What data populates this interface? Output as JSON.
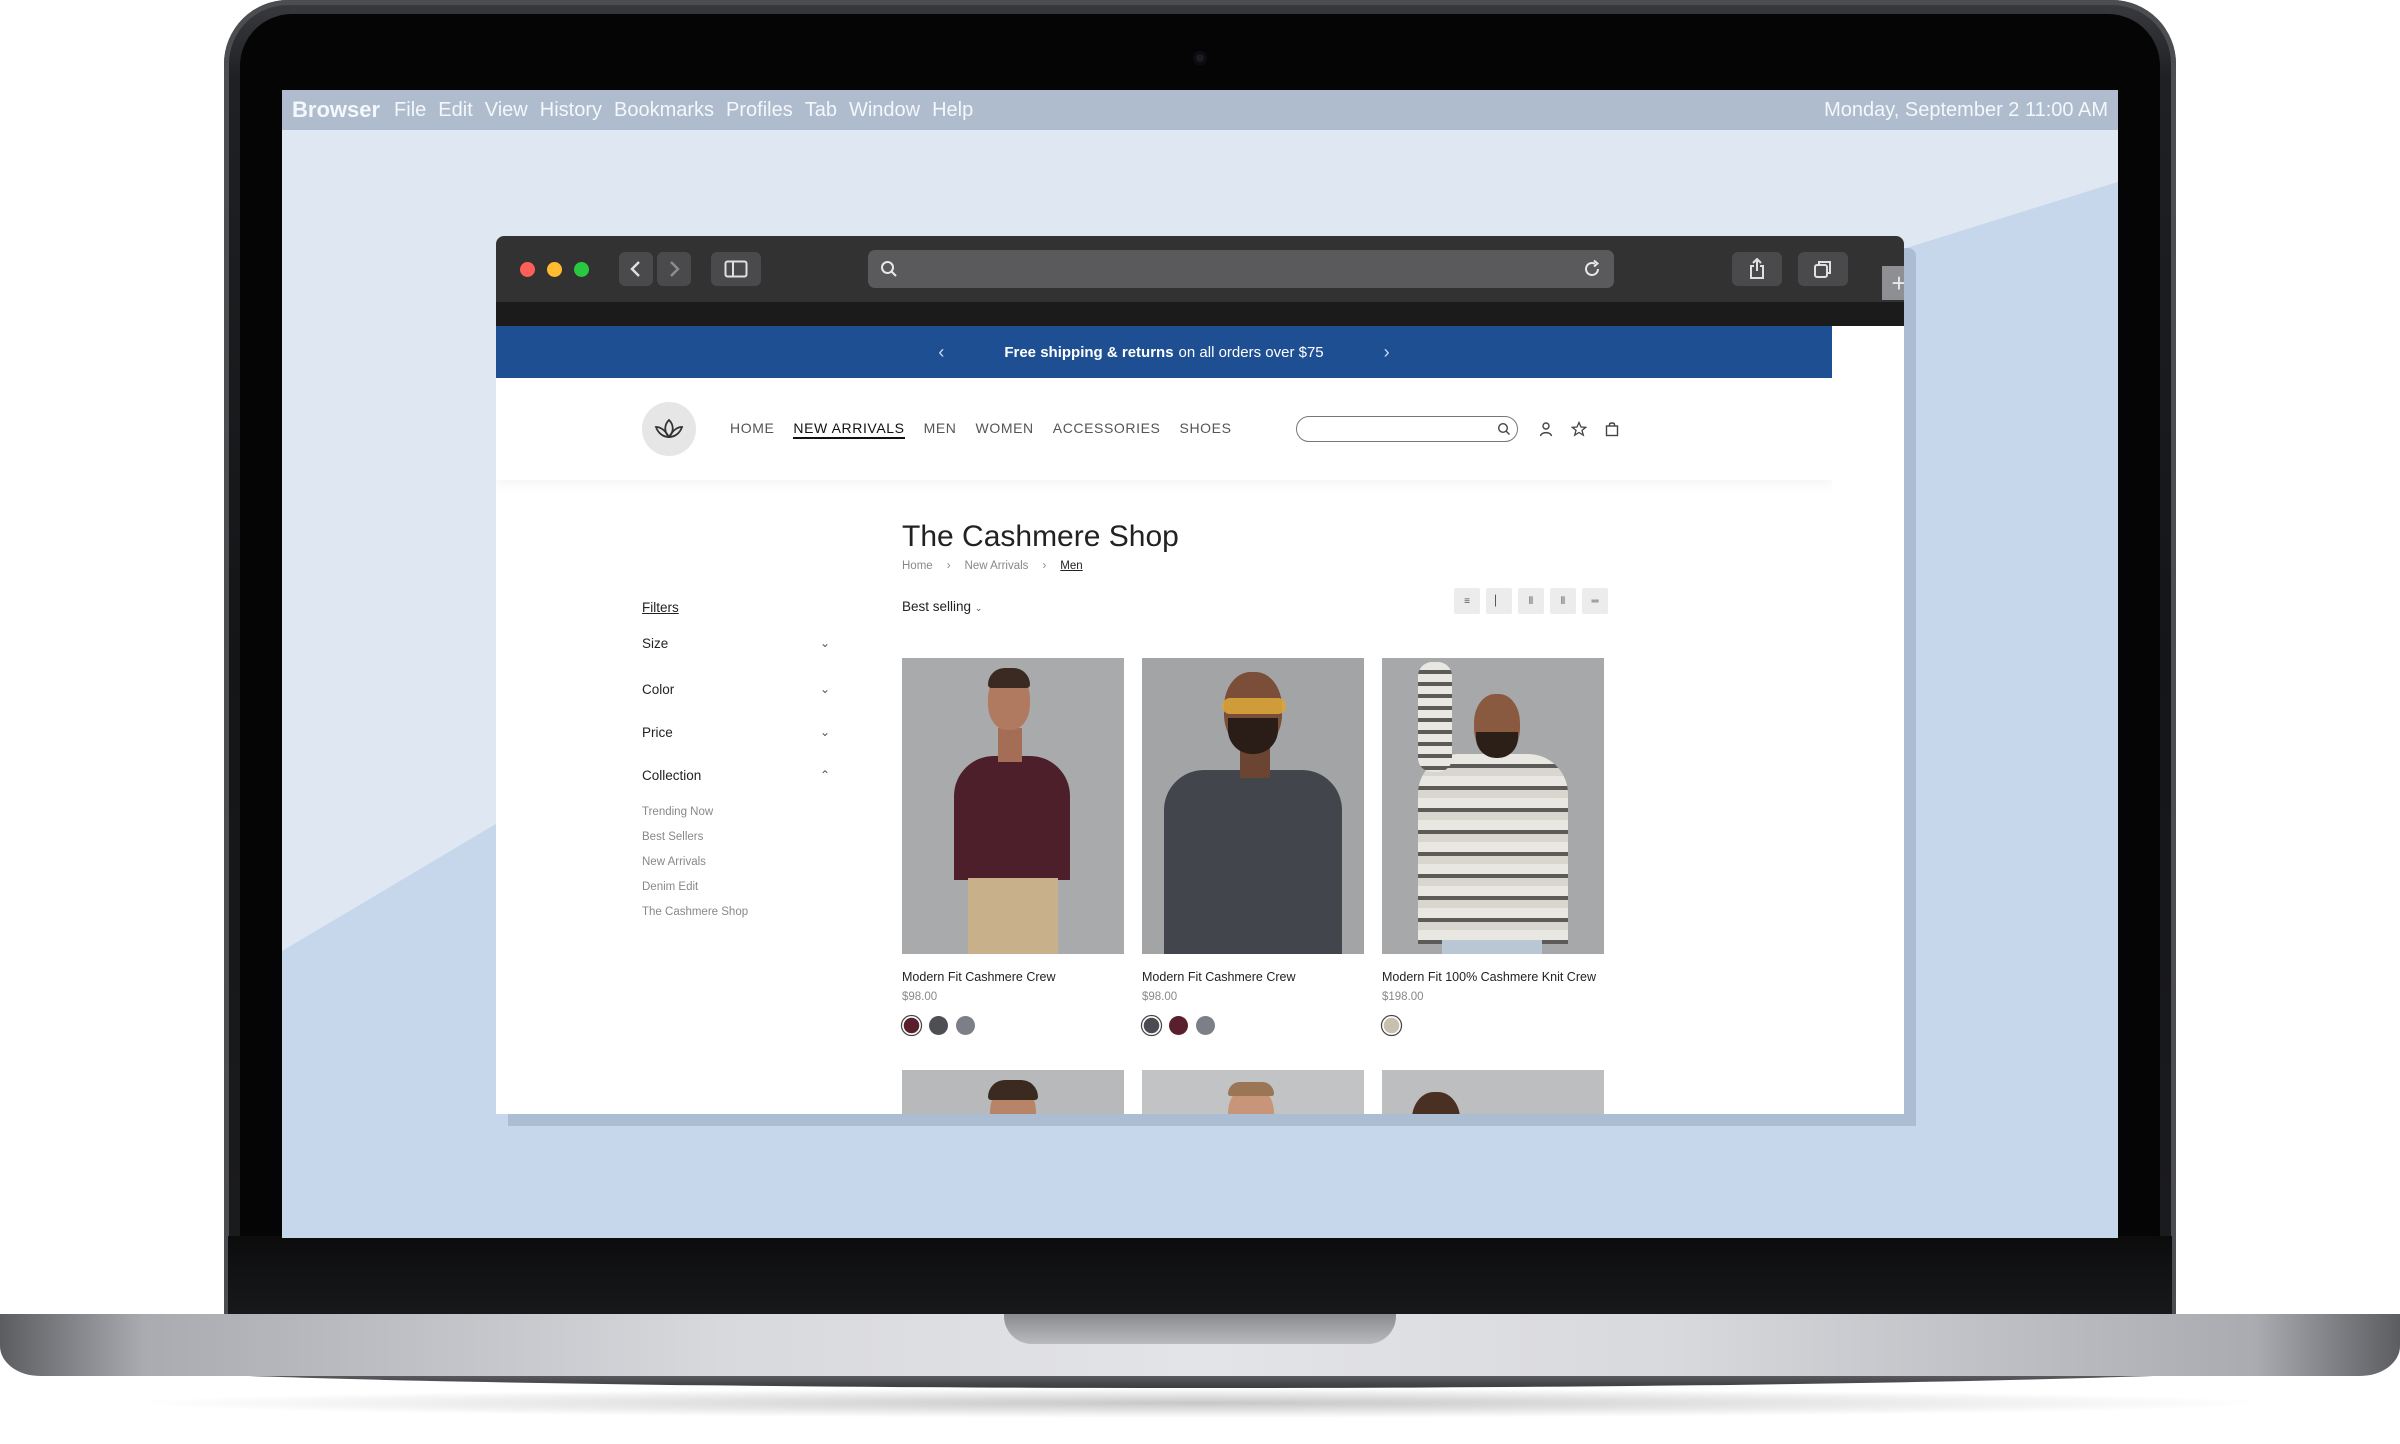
{
  "menubar": {
    "app_name": "Browser",
    "items": [
      "File",
      "Edit",
      "View",
      "History",
      "Bookmarks",
      "Profiles",
      "Tab",
      "Window",
      "Help"
    ],
    "clock": "Monday, September 2  11:00 AM"
  },
  "browser": {
    "address_value": ""
  },
  "promo": {
    "bold_text": "Free shipping & returns",
    "text": "on all orders over $75"
  },
  "nav": {
    "items": [
      "HOME",
      "NEW ARRIVALS",
      "MEN",
      "WOMEN",
      "ACCESSORIES",
      "SHOES"
    ],
    "active": "NEW ARRIVALS"
  },
  "search": {
    "value": ""
  },
  "page": {
    "title": "The Cashmere Shop",
    "breadcrumb": [
      "Home",
      "New Arrivals",
      "Men"
    ],
    "sort_label": "Best selling"
  },
  "filters": {
    "title": "Filters",
    "groups": [
      "Size",
      "Color",
      "Price",
      "Collection"
    ],
    "collection_items": [
      "Trending Now",
      "Best Sellers",
      "New Arrivals",
      "Denim Edit",
      "The Cashmere Shop"
    ]
  },
  "products": [
    {
      "name": "Modern Fit Cashmere Crew",
      "price": "$98.00",
      "swatches": [
        "#5a1f2c",
        "#4e4f52",
        "#7c7f88"
      ],
      "selected_swatch": 0
    },
    {
      "name": "Modern Fit Cashmere Crew",
      "price": "$98.00",
      "swatches": [
        "#4a4c52",
        "#5a1f2c",
        "#7c7f88"
      ],
      "selected_swatch": 0
    },
    {
      "name": "Modern Fit 100% Cashmere Knit Crew",
      "price": "$198.00",
      "swatches": [
        "#c9bfae"
      ],
      "selected_swatch": 0
    }
  ],
  "colors": {
    "promo_bg": "#1f4f93",
    "screen_bg": "#dfe8f2",
    "menubar_bg": "#aebccd"
  },
  "icons": {
    "search": "search-icon",
    "account": "user-icon",
    "wishlist": "star-icon",
    "cart": "bag-icon",
    "logo": "lotus-logo-icon"
  }
}
